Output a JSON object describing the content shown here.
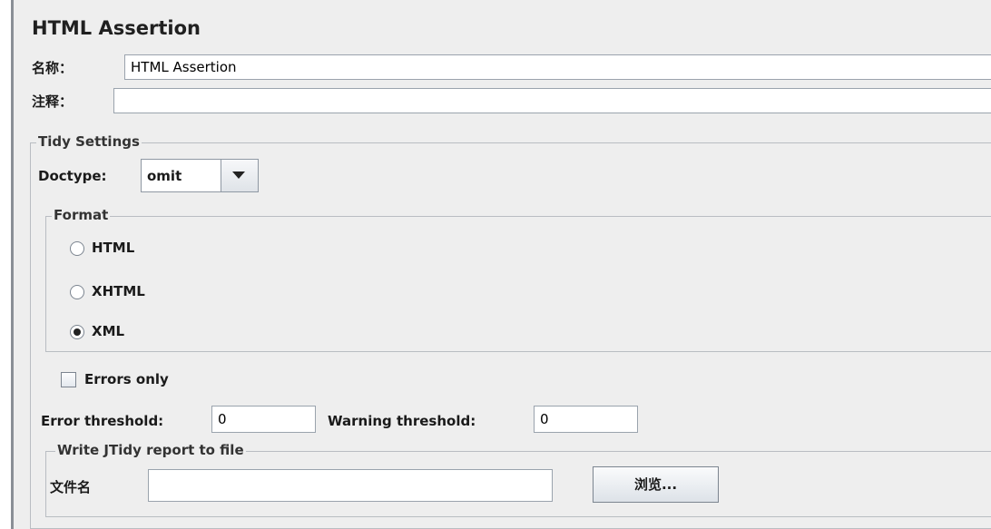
{
  "panel": {
    "title": "HTML Assertion"
  },
  "name_field": {
    "label": "名称：",
    "value": "HTML Assertion"
  },
  "comment_field": {
    "label": "注释：",
    "value": ""
  },
  "tidy_settings": {
    "title": "Tidy Settings",
    "doctype": {
      "label": "Doctype:",
      "selected": "omit"
    },
    "format": {
      "title": "Format",
      "options": [
        {
          "label": "HTML",
          "selected": false
        },
        {
          "label": "XHTML",
          "selected": false
        },
        {
          "label": "XML",
          "selected": true
        }
      ]
    },
    "errors_only": {
      "label": "Errors only",
      "checked": false
    },
    "error_threshold": {
      "label": "Error threshold:",
      "value": "0"
    },
    "warning_threshold": {
      "label": "Warning threshold:",
      "value": "0"
    }
  },
  "report": {
    "title": "Write JTidy report to file",
    "filename_label": "文件名",
    "filename_value": "",
    "browse_label": "浏览..."
  }
}
